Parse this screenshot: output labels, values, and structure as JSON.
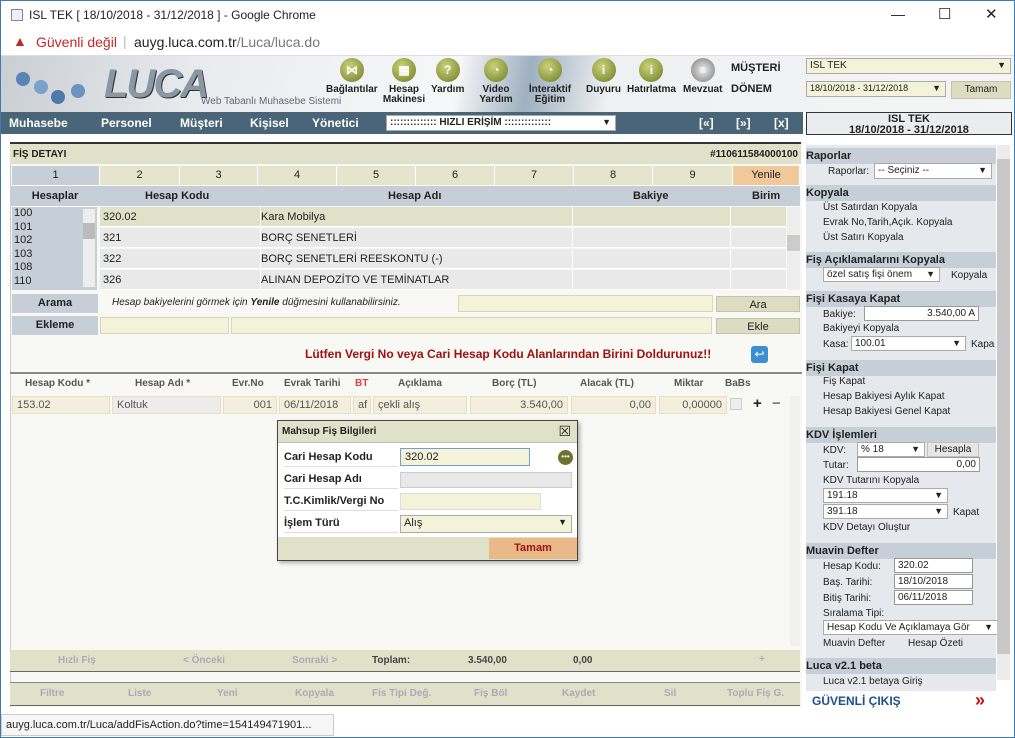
{
  "window": {
    "title": "ISL TEK [ 18/10/2018 - 31/12/2018 ] - Google Chrome",
    "minimize": "—",
    "maximize": "☐",
    "close": "✕"
  },
  "addressbar": {
    "security": "Güvenli değil",
    "host": "auyg.luca.com.tr",
    "path": "/Luca/luca.do"
  },
  "banner": {
    "logo": "LUCA",
    "tagline": "Web Tabanlı Muhasebe Sistemi",
    "icons": [
      {
        "label": "Bağlantılar",
        "icon": "share-icon"
      },
      {
        "label": "Hesap Makinesi",
        "icon": "calculator-icon"
      },
      {
        "label": "Yardım",
        "icon": "help-icon"
      },
      {
        "label": "Video Yardım",
        "icon": "video-icon"
      },
      {
        "label": "İnteraktif Eğitim",
        "icon": "chat-icon"
      },
      {
        "label": "Duyuru",
        "icon": "announcement-icon"
      },
      {
        "label": "Hatırlatma",
        "icon": "reminder-icon"
      },
      {
        "label": "Mevzuat",
        "icon": "document-icon"
      }
    ],
    "musteri_label": "MÜŞTERİ",
    "musteri_value": "ISL TEK",
    "donem_label": "DÖNEM",
    "donem_value": "18/10/2018 - 31/12/2018",
    "tamam": "Tamam"
  },
  "nav": {
    "items": [
      "Muhasebe",
      "Personel",
      "Müşteri",
      "Kişisel",
      "Yönetici"
    ],
    "quick": ":::::::::::::: HIZLI ERİŞİM ::::::::::::::",
    "prev": "[«]",
    "next": "[»]",
    "close": "[x]"
  },
  "period_box": {
    "company": "ISL TEK",
    "range": "18/10/2018 - 31/12/2018"
  },
  "fis": {
    "title": "FİŞ DETAYI",
    "number": "#110611584000100",
    "tabs": [
      "1",
      "2",
      "3",
      "4",
      "5",
      "6",
      "7",
      "8",
      "9"
    ],
    "refresh": "Yenile",
    "columns": {
      "hesaplar": "Hesaplar",
      "kod": "Hesap Kodu",
      "ad": "Hesap Adı",
      "bakiye": "Bakiye",
      "birim": "Birim"
    },
    "hesaplar": [
      "100",
      "101",
      "102",
      "103",
      "108",
      "110"
    ],
    "rows": [
      {
        "kod": "320.02",
        "ad": "Kara Mobilya"
      },
      {
        "kod": "321",
        "ad": "BORÇ SENETLERİ"
      },
      {
        "kod": "322",
        "ad": "BORÇ SENETLERİ REESKONTU (-)"
      },
      {
        "kod": "326",
        "ad": "ALINAN DEPOZİTO VE TEMİNATLAR"
      }
    ],
    "arama_label": "Arama",
    "arama_hint_1": "Hesap bakiyelerini görmek için ",
    "arama_hint_bold": "Yenile",
    "arama_hint_2": " düğmesini kullanabilirsiniz.",
    "ara": "Ara",
    "ekleme_label": "Ekleme",
    "ekle": "Ekle",
    "warning": "Lütfen Vergi No veya Cari Hesap Kodu Alanlarından Birini Doldurunuz!!"
  },
  "grid": {
    "headers": [
      "Hesap Kodu *",
      "Hesap Adı *",
      "Evr.No",
      "Evrak Tarihi",
      "BT",
      "Açıklama",
      "Borç (TL)",
      "Alacak (TL)",
      "Miktar",
      "BaBs"
    ],
    "row": {
      "kod": "153.02",
      "ad": "Koltuk",
      "evrno": "001",
      "tarih": "06/11/2018",
      "bt": "af",
      "aciklama": "çekli alış",
      "borc": "3.540,00",
      "alacak": "0,00",
      "miktar": "0,00000"
    },
    "add": "+",
    "remove": "−"
  },
  "totals": {
    "hizli": "Hızlı Fiş",
    "onceki": "< Önceki",
    "sonraki": "Sonraki >",
    "toplam": "Toplam:",
    "borc": "3.540,00",
    "alacak": "0,00",
    "plus": "+"
  },
  "toolbar": [
    "Filtre",
    "Liste",
    "Yeni",
    "Kopyala",
    "Fis Tipi Değ.",
    "Fiş Böl",
    "Kaydet",
    "Sil",
    "Toplu Fiş G."
  ],
  "dialog": {
    "title": "Mahsup Fiş Bilgileri",
    "close": "☒",
    "cari_kod_label": "Cari Hesap Kodu",
    "cari_kod": "320.02",
    "cari_ad_label": "Cari Hesap Adı",
    "vergi_label": "T.C.Kimlik/Vergi No",
    "islem_label": "İşlem Türü",
    "islem": "Alış",
    "ok": "Tamam"
  },
  "side": {
    "raporlar": "Raporlar",
    "raporlar_label": "Raporlar:",
    "raporlar_sel": "-- Seçiniz --",
    "kopyala": "Kopyala",
    "kopyala_items": [
      "Üst Satırdan Kopyala",
      "Evrak No,Tarih,Açık. Kopyala",
      "Üst Satırı Kopyala"
    ],
    "aciklama": "Fiş Açıklamalarını Kopyala",
    "aciklama_sel": "özel satış fişi önem",
    "aciklama_btn": "Kopyala",
    "kasa": "Fişi Kasaya Kapat",
    "bakiye_label": "Bakiye:",
    "bakiye": "3.540,00 A",
    "bakiye_kopyala": "Bakiyeyi Kopyala",
    "kasa_label": "Kasa:",
    "kasa_sel": "100.01",
    "kapa": "Kapa",
    "fiskapat": "Fişi Kapat",
    "fiskapat_items": [
      "Fiş Kapat",
      "Hesap Bakiyesi Aylık Kapat",
      "Hesap Bakiyesi Genel Kapat"
    ],
    "kdv": "KDV İşlemleri",
    "kdv_label": "KDV:",
    "kdv_sel": "% 18",
    "hesapla": "Hesapla",
    "tutar_label": "Tutar:",
    "tutar": "0,00",
    "kdv_kopyala": "KDV Tutarını Kopyala",
    "kdv_sel1": "191.18",
    "kdv_sel2": "391.18",
    "kapat": "Kapat",
    "kdv_detay": "KDV Detayı Oluştur",
    "muavin": "Muavin Defter",
    "hk_label": "Hesap Kodu:",
    "hk": "320.02",
    "bas_label": "Baş. Tarihi:",
    "bas": "18/10/2018",
    "bit_label": "Bitiş Tarihi:",
    "bit": "06/11/2018",
    "sira_label": "Sıralama Tipi:",
    "sira": "Hesap Kodu Ve Açıklamaya Gör",
    "muavin_btn": "Muavin Defter",
    "ozet_btn": "Hesap Özeti",
    "beta": "Luca v2.1 beta",
    "beta_item": "Luca v2.1 betaya Giriş",
    "logout": "GÜVENLİ ÇIKIŞ",
    "logout_icon": "»"
  },
  "status": "auyg.luca.com.tr/Luca/addFisAction.do?time=154149471901...",
  "colors": {
    "nav": "#4b6578",
    "header": "#e0e1c9",
    "accent_tab": "#f1c89a",
    "warning": "#a01010",
    "link": "#1f4e8c"
  }
}
